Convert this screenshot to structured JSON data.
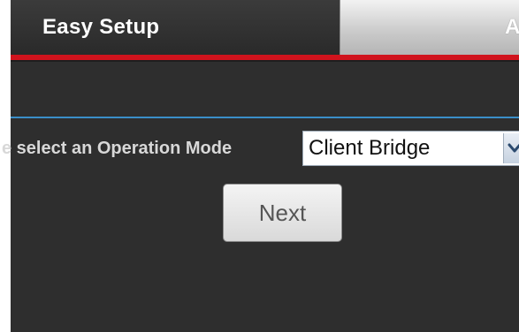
{
  "tabs": {
    "easy_setup": "Easy Setup",
    "advanced": "A"
  },
  "form": {
    "operation_mode_label": "e select an Operation Mode",
    "operation_mode_value": "Client Bridge",
    "next_label": "Next"
  },
  "colors": {
    "accent_red": "#d0131d",
    "divider_blue": "#3a8fc8",
    "panel_background": "#2e2e2e"
  },
  "icons": {
    "dropdown": "chevron-down-icon"
  }
}
